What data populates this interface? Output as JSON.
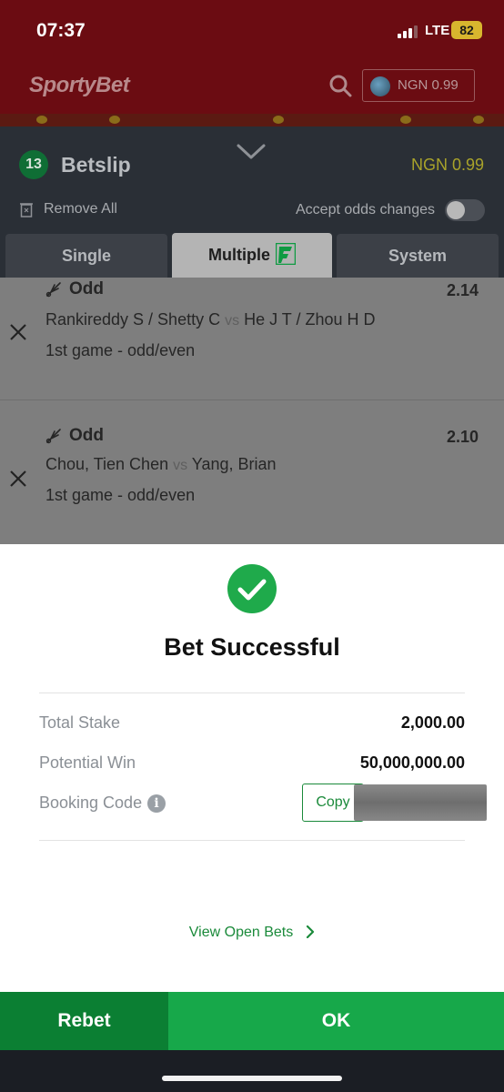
{
  "status_bar": {
    "time": "07:37",
    "network": "LTE",
    "battery": "82"
  },
  "app_header": {
    "logo": "SportyBet",
    "balance": "NGN 0.99"
  },
  "betslip": {
    "count": "13",
    "title": "Betslip",
    "balance": "NGN 0.99",
    "remove_all": "Remove All",
    "accept_odds_label": "Accept odds changes",
    "accept_odds_enabled": false,
    "tabs": [
      {
        "label": "Single",
        "active": false
      },
      {
        "label": "Multiple",
        "active": true
      },
      {
        "label": "System",
        "active": false
      }
    ],
    "bets": [
      {
        "pick": "Odd",
        "odds": "2.14",
        "home": "Rankireddy S / Shetty C",
        "vs": "vs",
        "away": "He J T / Zhou H D",
        "market": "1st game - odd/even"
      },
      {
        "pick": "Odd",
        "odds": "2.10",
        "home": "Chou, Tien Chen",
        "vs": "vs",
        "away": "Yang, Brian",
        "market": "1st game - odd/even"
      }
    ]
  },
  "success_sheet": {
    "title": "Bet Successful",
    "total_stake_label": "Total Stake",
    "total_stake_value": "2,000.00",
    "potential_win_label": "Potential Win",
    "potential_win_value": "50,000,000.00",
    "booking_code_label": "Booking Code",
    "copy_label": "Copy",
    "view_open_bets": "View Open Bets"
  },
  "actions": {
    "rebet": "Rebet",
    "ok": "OK"
  },
  "colors": {
    "brand_green": "#17a84a",
    "dark_green": "#0b7f33",
    "header_red": "#6b0c12",
    "success_green": "#1faa4b"
  }
}
